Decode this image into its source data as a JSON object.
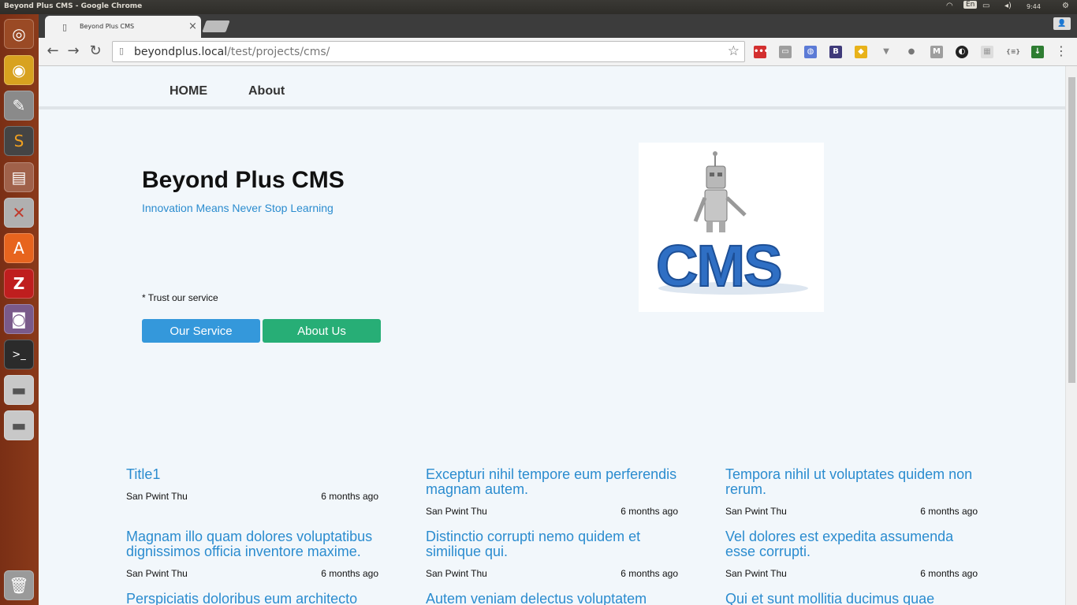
{
  "os": {
    "window_title": "Beyond Plus CMS - Google Chrome",
    "tray": {
      "lang": "En",
      "clock": "9:44"
    },
    "launcher": [
      "ubuntu-dash-icon",
      "chrome-icon",
      "text-editor-icon",
      "sublime-icon",
      "file-cabinet-icon",
      "settings-tools-icon",
      "software-center-icon",
      "filezilla-icon",
      "camera-icon",
      "terminal-icon",
      "drive-icon",
      "drive-icon-2",
      "trash-icon"
    ]
  },
  "browser": {
    "tab_title": "Beyond Plus CMS",
    "url_host": "beyondplus.local",
    "url_path": "/test/projects/cms/"
  },
  "site": {
    "nav": {
      "home": "HOME",
      "about": "About"
    },
    "hero": {
      "title": "Beyond Plus CMS",
      "tagline": "Innovation Means Never Stop Learning",
      "trust": "* Trust our service",
      "btn_service": "Our Service",
      "btn_about": "About Us",
      "image_icon": "cms-robot-image"
    },
    "posts": [
      {
        "title": "Title1",
        "author": "San Pwint Thu",
        "date": "6 months ago"
      },
      {
        "title": "Excepturi nihil tempore eum perferendis magnam autem.",
        "author": "San Pwint Thu",
        "date": "6 months ago"
      },
      {
        "title": "Tempora nihil ut voluptates quidem non rerum.",
        "author": "San Pwint Thu",
        "date": "6 months ago"
      },
      {
        "title": "Magnam illo quam dolores voluptatibus dignissimos officia inventore maxime.",
        "author": "San Pwint Thu",
        "date": "6 months ago"
      },
      {
        "title": "Distinctio corrupti nemo quidem et similique qui.",
        "author": "San Pwint Thu",
        "date": "6 months ago"
      },
      {
        "title": "Vel dolores est expedita assumenda esse corrupti.",
        "author": "San Pwint Thu",
        "date": "6 months ago"
      },
      {
        "title": "Perspiciatis doloribus eum architecto",
        "author": "",
        "date": ""
      },
      {
        "title": "Autem veniam delectus voluptatem",
        "author": "",
        "date": ""
      },
      {
        "title": "Qui et sunt mollitia ducimus quae",
        "author": "",
        "date": ""
      }
    ]
  }
}
